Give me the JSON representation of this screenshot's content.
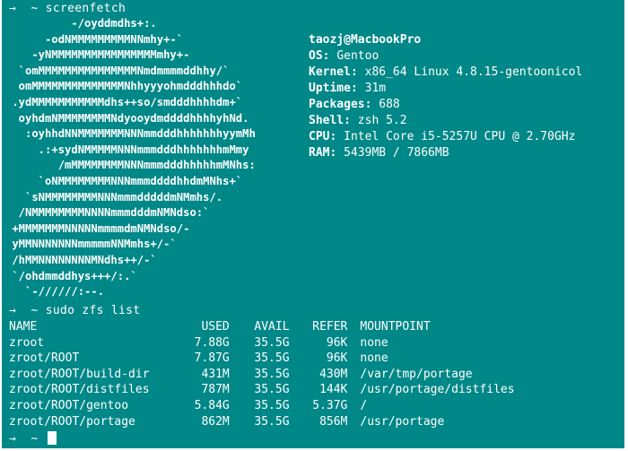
{
  "terminal": {
    "background": "#008787",
    "foreground": "#ffffff"
  },
  "prompt1": {
    "symbol": "→",
    "tilde": "~",
    "command": "screenfetch"
  },
  "ascii_art": [
    "          -/oyddmdhs+:.",
    "      -odNMMMMMMMMMNNmhy+-`",
    "    -yNMMMMMMMMMMMMMMMMmhy+-",
    "  `omMMMMMMMMMMMMMMMNmdmmmmddhhy/`",
    "  omMMMMMMMMMMMMMMNhhyyyohmdddhhhdo`",
    " .ydMMMMMMMMMMMdhs++so/smdddhhhhdm+`",
    "  oyhdmNMMMMMMMMNdyooydmddddhhhhyhNd.",
    "   :oyhhdNNMMMMMMMNNNmmdddhhhhhhhyymMh",
    "     .:+sydNMMMMMNNNmmmdddhhhhhhhmMmy",
    "        /mMMMMMMMMNNNmmmdddhhhhhmMNhs:",
    "     `oNMMMMMMMMNNNmmmddddhhdmMNhs+`",
    "   `sNMMMMMMMMNNNmmmdddddmNMmhs/.",
    "  /NMMMMMMMMNNNNmmmdddmNMNdso:`",
    " +MMMMMMMNNNNNmmmmdmNMNdso/-",
    " yMMNNNNNNNmmmmmNNMmhs+/-`",
    " /hMMNNNNNNNNMNdhs++/-`",
    " `/ohdmmddhys+++/:.`",
    "   `-//////:--."
  ],
  "info": {
    "user_host": "taozj@MacbookPro",
    "rows": [
      {
        "key": "OS:",
        "value": "Gentoo"
      },
      {
        "key": "Kernel:",
        "value": "x86_64 Linux 4.8.15-gentoonicol"
      },
      {
        "key": "Uptime:",
        "value": "31m"
      },
      {
        "key": "Packages:",
        "value": "688"
      },
      {
        "key": "Shell:",
        "value": "zsh 5.2"
      },
      {
        "key": "CPU:",
        "value": "Intel Core i5-5257U CPU @ 2.70GHz"
      },
      {
        "key": "RAM:",
        "value": "5439MB / 7866MB"
      }
    ]
  },
  "prompt2": {
    "symbol": "→",
    "tilde": "~",
    "command": "sudo zfs list"
  },
  "zfs": {
    "headers": [
      "NAME",
      "USED",
      "AVAIL",
      "REFER",
      "MOUNTPOINT"
    ],
    "rows": [
      [
        "zroot",
        "7.88G",
        "35.5G",
        "96K",
        "none"
      ],
      [
        "zroot/ROOT",
        "7.87G",
        "35.5G",
        "96K",
        "none"
      ],
      [
        "zroot/ROOT/build-dir",
        "431M",
        "35.5G",
        "430M",
        "/var/tmp/portage"
      ],
      [
        "zroot/ROOT/distfiles",
        "787M",
        "35.5G",
        "144K",
        "/usr/portage/distfiles"
      ],
      [
        "zroot/ROOT/gentoo",
        "5.84G",
        "35.5G",
        "5.37G",
        "/"
      ],
      [
        "zroot/ROOT/portage",
        "862M",
        "35.5G",
        "856M",
        "/usr/portage"
      ]
    ]
  },
  "prompt3": {
    "symbol": "→",
    "tilde": "~"
  }
}
